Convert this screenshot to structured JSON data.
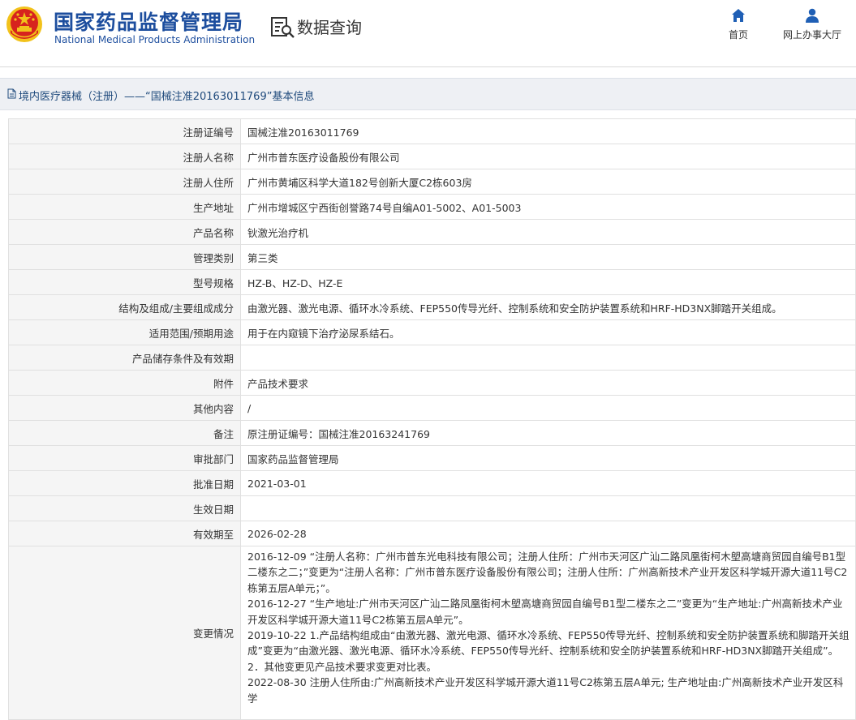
{
  "header": {
    "logo_cn": "国家药品监督管理局",
    "logo_en": "National Medical Products Administration",
    "query_title": "数据查询",
    "nav": [
      {
        "label": "首页",
        "icon": "home-icon"
      },
      {
        "label": "网上办事大厅",
        "icon": "user-icon"
      }
    ]
  },
  "breadcrumb": {
    "icon": "document-icon",
    "text": "境内医疗器械（注册）——“国械注准20163011769”基本信息"
  },
  "fields": [
    {
      "label": "注册证编号",
      "value": "国械注准20163011769"
    },
    {
      "label": "注册人名称",
      "value": "广州市普东医疗设备股份有限公司"
    },
    {
      "label": "注册人住所",
      "value": "广州市黄埔区科学大道182号创新大厦C2栋603房"
    },
    {
      "label": "生产地址",
      "value": "广州市增城区宁西街创誉路74号自编A01-5002、A01-5003"
    },
    {
      "label": "产品名称",
      "value": "钬激光治疗机"
    },
    {
      "label": "管理类别",
      "value": "第三类"
    },
    {
      "label": "型号规格",
      "value": "HZ-B、HZ-D、HZ-E"
    },
    {
      "label": "结构及组成/主要组成成分",
      "value": "由激光器、激光电源、循环水冷系统、FEP550传导光纤、控制系统和安全防护装置系统和HRF-HD3NX脚踏开关组成。"
    },
    {
      "label": "适用范围/预期用途",
      "value": "用于在内窥镜下治疗泌尿系结石。"
    },
    {
      "label": "产品储存条件及有效期",
      "value": ""
    },
    {
      "label": "附件",
      "value": "产品技术要求"
    },
    {
      "label": "其他内容",
      "value": "/"
    },
    {
      "label": "备注",
      "value": "原注册证编号：国械注准20163241769"
    },
    {
      "label": "审批部门",
      "value": "国家药品监督管理局"
    },
    {
      "label": "批准日期",
      "value": "2021-03-01"
    },
    {
      "label": "生效日期",
      "value": ""
    },
    {
      "label": "有效期至",
      "value": "2026-02-28"
    }
  ],
  "changes": {
    "label": "变更情况",
    "paragraphs": [
      "2016-12-09 “注册人名称：广州市普东光电科技有限公司；注册人住所：广州市天河区广汕二路凤凰街柯木塱高塘商贸园自编号B1型二楼东之二；”变更为“注册人名称：广州市普东医疗设备股份有限公司；注册人住所：广州高新技术产业开发区科学城开源大道11号C2栋第五层A单元；”。",
      "2016-12-27 “生产地址:广州市天河区广汕二路凤凰街柯木塱高塘商贸园自编号B1型二楼东之二”变更为“生产地址:广州高新技术产业开发区科学城开源大道11号C2栋第五层A单元”。",
      "2019-10-22 1.产品结构组成由“由激光器、激光电源、循环水冷系统、FEP550传导光纤、控制系统和安全防护装置系统和脚踏开关组成”变更为“由激光器、激光电源、循环水冷系统、FEP550传导光纤、控制系统和安全防护装置系统和HRF-HD3NX脚踏开关组成”。",
      "2．其他变更见产品技术要求变更对比表。",
      "2022-08-30 注册人住所由:广州高新技术产业开发区科学城开源大道11号C2栋第五层A单元; 生产地址由:广州高新技术产业开发区科学"
    ]
  },
  "colors": {
    "brand_blue": "#1d4e9e",
    "emblem_red": "#d7231e",
    "emblem_gold": "#f2c21b",
    "label_bg": "#f5f5f5",
    "crumb_bg": "#eef0f4",
    "nav_icon": "#1f5fb5"
  }
}
